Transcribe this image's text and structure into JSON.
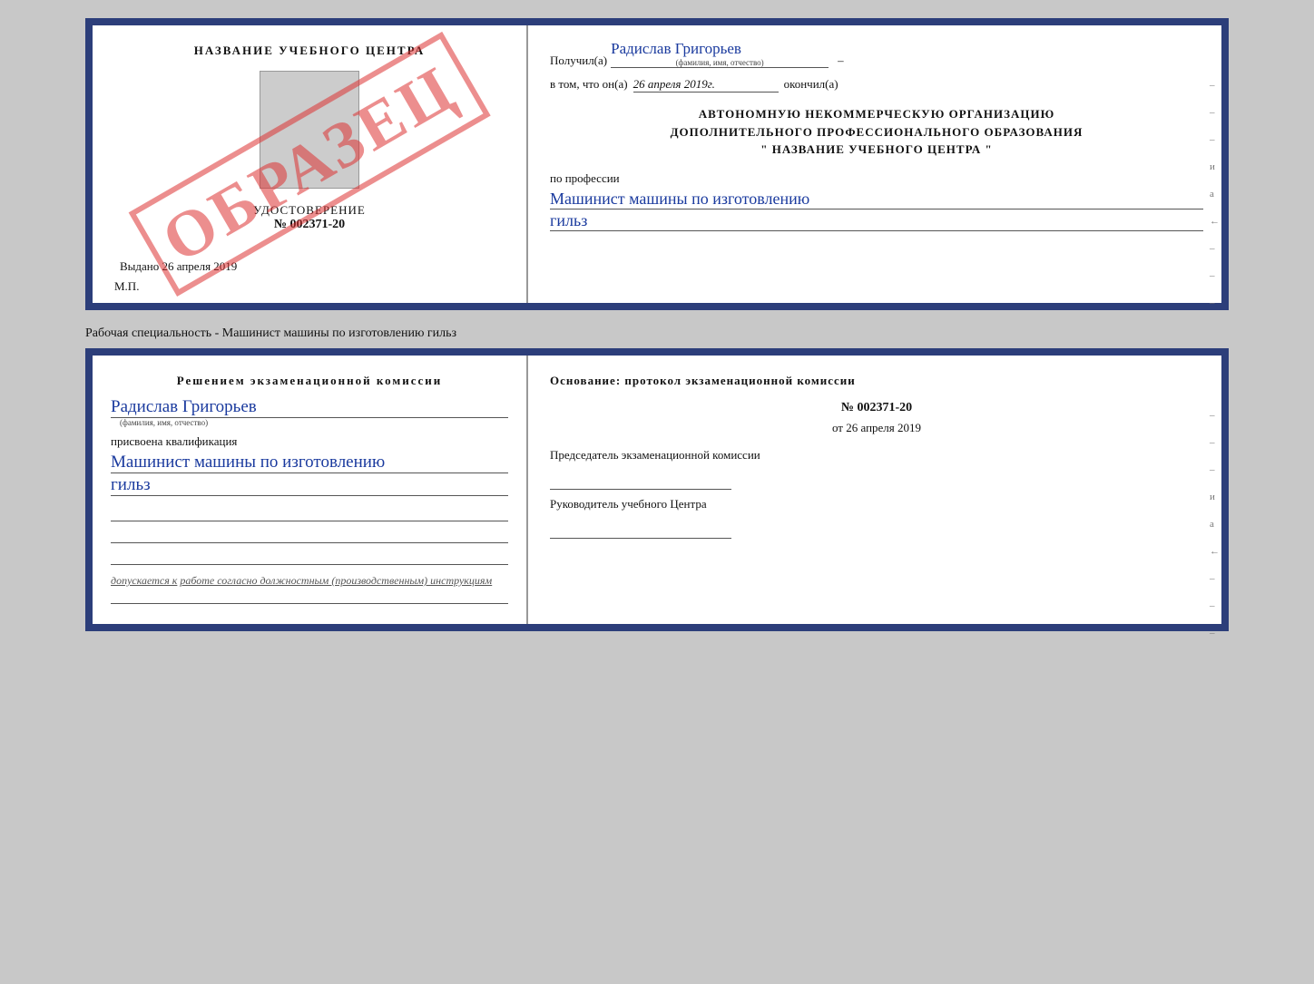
{
  "top_cert": {
    "left": {
      "center_title": "НАЗВАНИЕ УЧЕБНОГО ЦЕНТРА",
      "watermark": "ОБРАЗЕЦ",
      "doc_label": "УДОСТОВЕРЕНИЕ",
      "doc_number": "№ 002371-20",
      "issued_label": "Выдано",
      "issued_date": "26 апреля 2019",
      "mp_label": "М.П."
    },
    "right": {
      "received_label": "Получил(а)",
      "recipient_name": "Радислав Григорьев",
      "name_sub": "(фамилия, имя, отчество)",
      "date_prefix": "в том, что он(а)",
      "date_value": "26 апреля 2019г.",
      "date_suffix": "окончил(а)",
      "org_line1": "АВТОНОМНУЮ НЕКОММЕРЧЕСКУЮ ОРГАНИЗАЦИЮ",
      "org_line2": "ДОПОЛНИТЕЛЬНОГО ПРОФЕССИОНАЛЬНОГО ОБРАЗОВАНИЯ",
      "org_name": "НАЗВАНИЕ УЧЕБНОГО ЦЕНТРА",
      "profession_label": "по профессии",
      "profession_value1": "Машинист машины по изготовлению",
      "profession_value2": "гильз",
      "side_marks": [
        "–",
        "–",
        "–",
        "и",
        "а",
        "←",
        "–",
        "–",
        "–"
      ]
    }
  },
  "subtitle": "Рабочая специальность - Машинист машины по изготовлению гильз",
  "bottom_cert": {
    "left": {
      "heading": "Решением  экзаменационной  комиссии",
      "name_cursive": "Радислав Григорьев",
      "name_sub": "(фамилия, имя, отчество)",
      "qual_label": "присвоена квалификация",
      "qual_value1": "Машинист  машины  по  изготовлению",
      "qual_value2": "гильз",
      "admit_prefix": "допускается к",
      "admit_text": "работе согласно должностным (производственным) инструкциям"
    },
    "right": {
      "basis_label": "Основание: протокол экзаменационной  комиссии",
      "protocol_number": "№  002371-20",
      "protocol_date_prefix": "от",
      "protocol_date": "26 апреля 2019",
      "chairman_label": "Председатель экзаменационной комиссии",
      "director_label": "Руководитель учебного Центра",
      "side_marks": [
        "–",
        "–",
        "–",
        "и",
        "а",
        "←",
        "–",
        "–",
        "–"
      ]
    }
  }
}
